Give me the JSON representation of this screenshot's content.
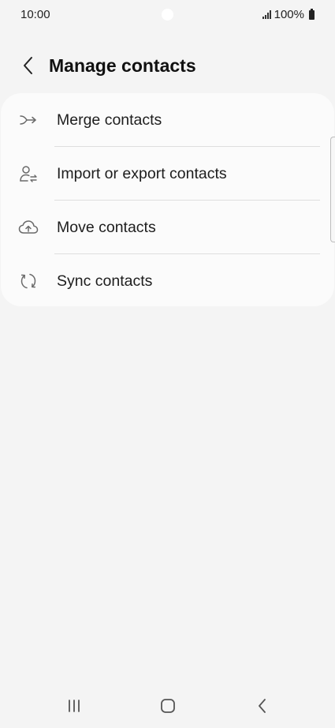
{
  "status_bar": {
    "time": "10:00",
    "battery": "100%"
  },
  "header": {
    "title": "Manage contacts",
    "back_icon": "chevron-left-icon"
  },
  "menu": {
    "items": [
      {
        "label": "Merge contacts",
        "icon": "merge-arrow-icon"
      },
      {
        "label": "Import or export contacts",
        "icon": "person-transfer-icon"
      },
      {
        "label": "Move contacts",
        "icon": "cloud-upload-icon"
      },
      {
        "label": "Sync contacts",
        "icon": "sync-icon"
      }
    ]
  },
  "nav_bar": {
    "recents_icon": "recents-icon",
    "home_icon": "home-icon",
    "back_icon": "back-icon"
  },
  "colors": {
    "background": "#f4f4f4",
    "card": "#fbfbfb",
    "text": "#1d1d1d",
    "icon": "#6a6a6a",
    "divider": "#dedede"
  }
}
